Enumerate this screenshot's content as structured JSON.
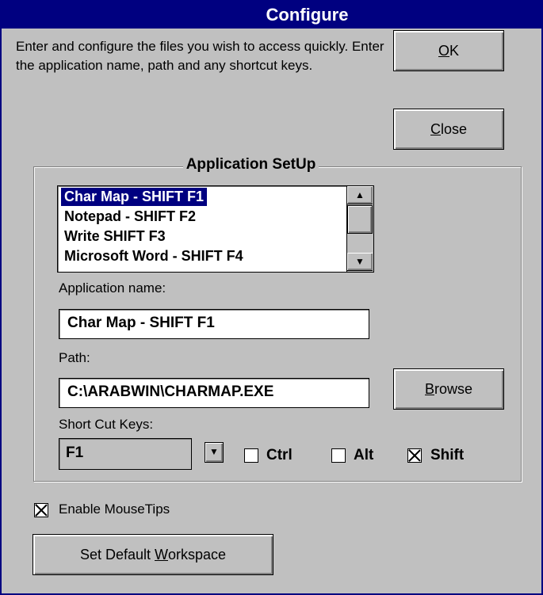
{
  "window": {
    "title": "Configure"
  },
  "intro_text": "Enter and configure the files you wish to access quickly. Enter the application name, path and any shortcut keys.",
  "buttons": {
    "ok_underline": "O",
    "ok_rest": "K",
    "close_underline": "C",
    "close_rest": "lose",
    "browse_underline": "B",
    "browse_rest": "rowse",
    "workspace_pre": "Set Default ",
    "workspace_underline": "W",
    "workspace_rest": "orkspace"
  },
  "group": {
    "title": "Application SetUp"
  },
  "app_list": {
    "items": [
      "Char Map - SHIFT F1",
      "Notepad - SHIFT F2",
      "Write SHIFT F3",
      "Microsoft Word - SHIFT F4"
    ],
    "selected_index": 0
  },
  "labels": {
    "app_name": "Application name:",
    "path": "Path:",
    "shortcut": "Short Cut Keys:"
  },
  "fields": {
    "app_name": "Char Map - SHIFT F1",
    "path": "C:\\ARABWIN\\CHARMAP.EXE",
    "shortcut_key": "F1"
  },
  "modifiers": {
    "ctrl_label": "Ctrl",
    "ctrl_checked": false,
    "alt_label": "Alt",
    "alt_checked": false,
    "shift_label": "Shift",
    "shift_checked": true
  },
  "mousetips": {
    "label": "Enable MouseTips",
    "checked": true
  },
  "icons": {
    "scroll_up": "arrow-up-icon",
    "scroll_down": "arrow-down-icon",
    "dropdown": "chevron-down-icon"
  }
}
